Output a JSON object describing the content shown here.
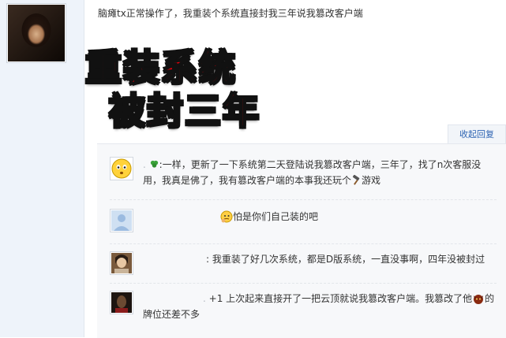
{
  "post": {
    "text": "脑瘫tx正常操作了，我重装个系统直接封我三年说我篡改客户端"
  },
  "overlay": {
    "line1": "重装系统",
    "line2": "被封三年"
  },
  "collapse_label": "收起回复",
  "replies": [
    {
      "name_mask": ".",
      "text_a": ":一样，更新了一下系统第二天登陆说我篡改客户端，三年了，找了n次客服没用，我真是佛了，我有篡改客户端的本事我还玩个",
      "text_b": "游戏"
    },
    {
      "text": "怕是你们自己装的吧"
    },
    {
      "text": ": 我重装了好几次系统，都是D版系统，一直没事啊，四年没被封过"
    },
    {
      "name_mask": ".",
      "text_a": "+1 上次起来直接开了一把云顶就说我篡改客户端。我篡改了他",
      "text_b": "的牌位还差不多"
    }
  ],
  "icons": {
    "op_avatar": "user-avatar-icon",
    "reply1_avatar": "emoji-face-avatar-icon",
    "reply2_avatar": "default-user-avatar-icon",
    "reply3_avatar": "user-photo-avatar-icon",
    "reply4_avatar": "user-photo-avatar-icon"
  }
}
